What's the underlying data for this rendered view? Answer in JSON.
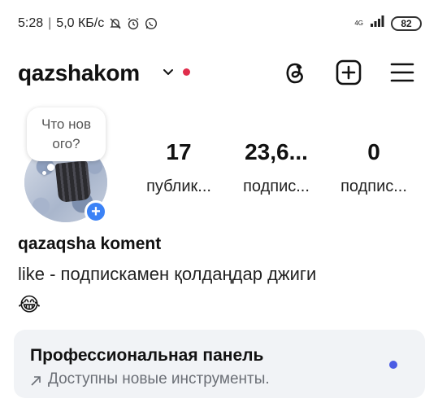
{
  "status_bar": {
    "time": "5:28",
    "separator": "|",
    "network_speed": "5,0 КБ/с",
    "network_type": "4G",
    "battery": "82",
    "icons": [
      "bell-muted-icon",
      "alarm-icon",
      "whatsapp-icon",
      "signal-icon",
      "battery-icon"
    ]
  },
  "header": {
    "username": "qazshakom",
    "notification_dot_color": "#e02e4c",
    "icons": [
      "threads-icon",
      "create-plus-icon",
      "menu-icon"
    ]
  },
  "profile": {
    "note": "Что нов ого?",
    "add_story_symbol": "+",
    "stats": [
      {
        "number": "17",
        "label": "публик..."
      },
      {
        "number": "23,6...",
        "label": "подпис..."
      },
      {
        "number": "0",
        "label": "подпис..."
      }
    ],
    "display_name": "qazaqsha koment",
    "bio": "like - подпискамен қолдаңдар джиги",
    "bio_emoji": "😂"
  },
  "pro_dashboard": {
    "title": "Профессиональная панель",
    "subtitle": "Доступны новые инструменты.",
    "dot_color": "#4b5ce4"
  }
}
